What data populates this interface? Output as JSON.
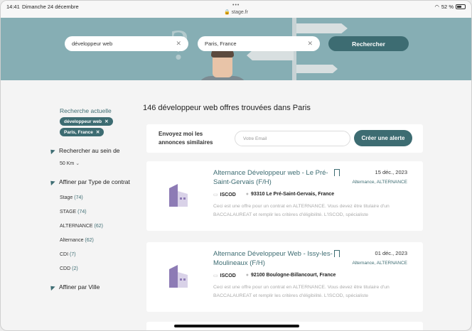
{
  "status": {
    "time": "14:41",
    "date": "Dimanche 24 décembre",
    "url": "stage.fr",
    "battery": "52 %"
  },
  "search": {
    "query": "développeur web",
    "location": "Paris, France",
    "button": "Rechercher"
  },
  "sidebar": {
    "current_search_title": "Recherche actuelle",
    "chips": [
      "développeur web",
      "Paris, France"
    ],
    "radius_title": "Rechercher au sein de",
    "radius_value": "50 Km",
    "type_title": "Affiner par Type de contrat",
    "filters": [
      {
        "label": "Stage",
        "count": "(74)"
      },
      {
        "label": "STAGE",
        "count": "(74)"
      },
      {
        "label": "ALTERNANCE",
        "count": "(62)"
      },
      {
        "label": "Alternance",
        "count": "(62)"
      },
      {
        "label": "CDI",
        "count": "(7)"
      },
      {
        "label": "CDD",
        "count": "(2)"
      }
    ],
    "city_title": "Affiner par Ville"
  },
  "results": {
    "title": "146 développeur web offres trouvées dans Paris",
    "alert_label": "Envoyez moi les annonces similaires",
    "email_placeholder": "Votre Email",
    "alert_button": "Créer une alerte",
    "offers": [
      {
        "title": "Alternance Développeur web - Le Pré-Saint-Gervais (F/H)",
        "date": "15 déc., 2023",
        "tags": "Alternance, ALTERNANCE",
        "company": "ISCOD",
        "location": "93310 Le Pré-Saint-Gervais, France",
        "description": "Ceci est une offre pour un contrat en ALTERNANCE. Vous devez être titulaire d'un BACCALAUREAT et remplir les critères d'éligibilité. L'ISCOD, spécialiste"
      },
      {
        "title": "Alternance Développeur Web - Issy-les-Moulineaux (F/H)",
        "date": "01 déc., 2023",
        "tags": "Alternance, ALTERNANCE",
        "company": "ISCOD",
        "location": "92100 Boulogne-Billancourt, France",
        "description": "Ceci est une offre pour un contrat en ALTERNANCE. Vous devez être titulaire d'un BACCALAUREAT et remplir les critères d'éligibilité. L'ISCOD, spécialiste"
      }
    ]
  },
  "colors": {
    "accent": "#3d6c72",
    "hero": "#86aeb4"
  }
}
